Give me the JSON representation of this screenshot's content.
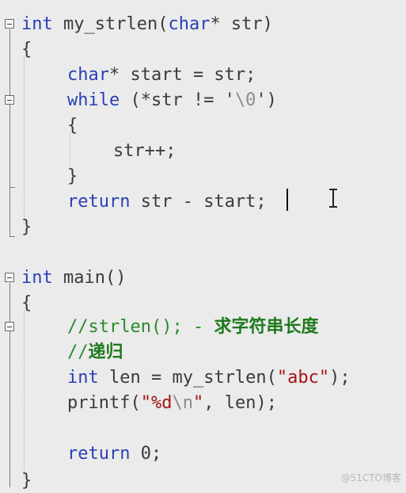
{
  "editor": {
    "lines": {
      "l1": {
        "kw": "int",
        "rest": " my_strlen(",
        "kw2": "char",
        "rest2": "* str)"
      },
      "l2": "{",
      "l3": {
        "kw": "char",
        "rest": "* start = str;"
      },
      "l4": {
        "kw": "while",
        "rest": " (*str != '",
        "esc": "\\0",
        "rest2": "')"
      },
      "l5": "{",
      "l6": "str++;",
      "l7": "}",
      "l8": {
        "kw": "return",
        "rest": " str - start;"
      },
      "l9": "}",
      "l10": {
        "kw": "int",
        "rest": " main()"
      },
      "l11": "{",
      "l12": {
        "cmt": "//strlen(); - ",
        "cmtcn": "求字符串长度"
      },
      "l13": {
        "cmt": "//",
        "cmtcn": "递归"
      },
      "l14": {
        "kw": "int",
        "rest": " len = my_strlen(",
        "str": "\"abc\"",
        "rest2": ");"
      },
      "l15": {
        "rest": "printf(",
        "str": "\"%d",
        "esc": "\\n",
        "str2": "\"",
        "rest2": ", len);"
      },
      "l16": {
        "kw": "return",
        "rest": " 0;"
      },
      "l17": "}"
    }
  },
  "watermark": "@51CTO博客"
}
